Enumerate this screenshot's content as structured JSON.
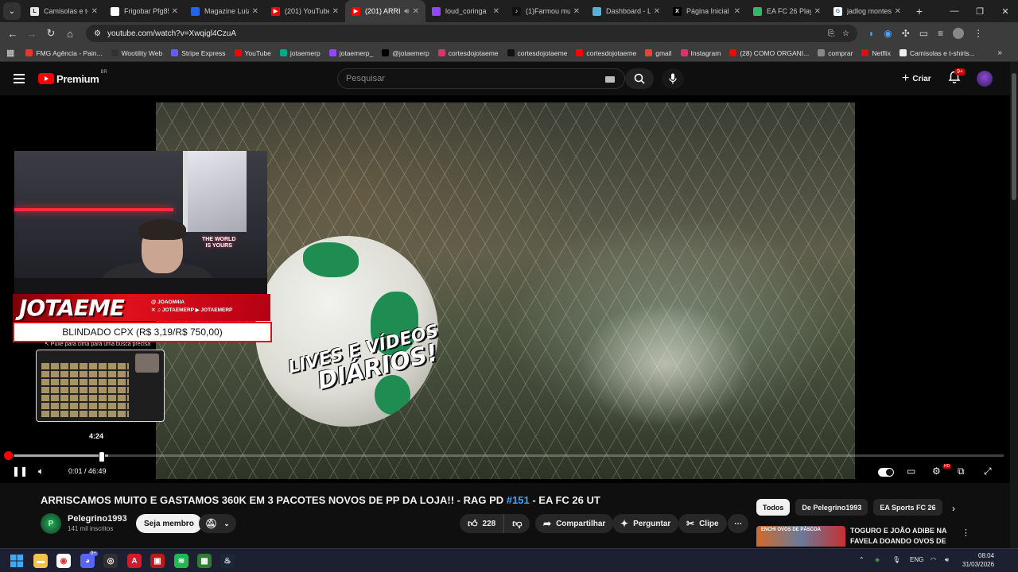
{
  "browser": {
    "tabs": [
      {
        "title": "Camisolas e t-s",
        "icon_color": "#e6e6e6",
        "icon_text": "L",
        "icon_text_color": "#111"
      },
      {
        "title": "Frigobar Pfg85",
        "icon_color": "#ffffff",
        "icon_text": "",
        "icon_text_color": "#111"
      },
      {
        "title": "Magazine Luiza",
        "icon_color": "#2463eb",
        "icon_text": "",
        "icon_text_color": "#fff"
      },
      {
        "title": "(201) YouTube",
        "icon_color": "#ff0000",
        "icon_text": "▶",
        "icon_text_color": "#fff"
      },
      {
        "title": "(201) ARRI",
        "icon_color": "#ff0000",
        "icon_text": "▶",
        "icon_text_color": "#fff"
      },
      {
        "title": "loud_coringa",
        "icon_color": "#9146ff",
        "icon_text": "",
        "icon_text_color": "#fff"
      },
      {
        "title": "(1)Farmou mui",
        "icon_color": "#111111",
        "icon_text": "♪",
        "icon_text_color": "#fff"
      },
      {
        "title": "Dashboard - L",
        "icon_color": "#5ab0d6",
        "icon_text": "",
        "icon_text_color": "#fff"
      },
      {
        "title": "Página Inicial /",
        "icon_color": "#000000",
        "icon_text": "X",
        "icon_text_color": "#fff"
      },
      {
        "title": "EA FC 26 Playe",
        "icon_color": "#2fb86a",
        "icon_text": "",
        "icon_text_color": "#fff"
      },
      {
        "title": "jadlog montes",
        "icon_color": "#ffffff",
        "icon_text": "G",
        "icon_text_color": "#4285f4"
      }
    ],
    "active_tab": 4,
    "new_tab": "+",
    "url": "youtube.com/watch?v=Xwqigl4CzuA",
    "bookmarks": [
      {
        "label": "FMG Agência - Pain...",
        "color": "#e33"
      },
      {
        "label": "Wootility Web",
        "color": "#333"
      },
      {
        "label": "Stripe Express",
        "color": "#635bff"
      },
      {
        "label": "YouTube",
        "color": "#f00"
      },
      {
        "label": "jotaemerp",
        "color": "#0a8"
      },
      {
        "label": "jotaemerp_",
        "color": "#9146ff"
      },
      {
        "label": "@jotaemerp",
        "color": "#000"
      },
      {
        "label": "cortesdojotaeme",
        "color": "#e1306c"
      },
      {
        "label": "cortesdojotaeme",
        "color": "#111"
      },
      {
        "label": "cortesdojotaeme",
        "color": "#f00"
      },
      {
        "label": "gmail",
        "color": "#ea4335"
      },
      {
        "label": "Instagram",
        "color": "#e1306c"
      },
      {
        "label": "(28) COMO ORGANI...",
        "color": "#f00"
      },
      {
        "label": "comprar",
        "color": "#888"
      },
      {
        "label": "Netflix",
        "color": "#e50914"
      },
      {
        "label": "Camisolas e t-shirts...",
        "color": "#eee"
      }
    ]
  },
  "youtube": {
    "logo_text": "Premium",
    "logo_region": "BR",
    "search_placeholder": "Pesquisar",
    "create_label": "Criar",
    "notifications_badge": "9+",
    "player": {
      "overlay_text_line1": "LIVES E VÍDEOS",
      "overlay_text_line2": "DIÁRIOS!",
      "streamer_name": "JOTAEME",
      "socials": [
        "@ JOAOM4IA",
        "✕ ♫ JOTAEMERP  ▶ JOTAEMERP"
      ],
      "cam_sign": "THE WORLD\nIS YOURS",
      "price_bar": "BLINDADO CPX (R$ 3,19/R$ 750,00)",
      "hint_text": "↖ Puxe para cima para uma busca precisa",
      "preview_time": "4:24",
      "current_time": "0:01",
      "duration": "46:49",
      "time_display": "0:01 / 46:49",
      "played_fraction": 0.0004,
      "hover_fraction": 0.094,
      "settings_badge": "HD"
    },
    "video": {
      "title_main": "ARRISCAMOS MUITO E GASTAMOS 360K EM 3 PACOTES NOVOS DE PP DA LOJA!! - RAG PD ",
      "title_tag": "#151",
      "title_end": " - EA FC 26 UT",
      "channel": "Pelegrino1993",
      "channel_initial": "P",
      "subscribers": "141 mil inscritos",
      "member_button": "Seja membro",
      "likes": "228",
      "share": "Compartilhar",
      "ask": "Perguntar",
      "clip": "Clipe",
      "more": "⋯"
    },
    "chips": [
      "Todos",
      "De Pelegrino1993",
      "EA Sports FC 26"
    ],
    "recommended": {
      "title": "TOGURO E JOÃO ADIBE NA FAVELA DOANDO OVOS DE ...",
      "thumb_text": "ENCHI OVOS DE PÁSCOA"
    }
  },
  "taskbar": {
    "apps": [
      {
        "name": "file-explorer",
        "color": "#f2c14e",
        "glyph": "▬"
      },
      {
        "name": "chrome",
        "color": "#ffffff",
        "glyph": "◉"
      },
      {
        "name": "discord",
        "color": "#5865f2",
        "glyph": "◕"
      },
      {
        "name": "obs",
        "color": "#303030",
        "glyph": "◎"
      },
      {
        "name": "app-red-a",
        "color": "#d11a2a",
        "glyph": "A"
      },
      {
        "name": "app-red-b",
        "color": "#b71c1c",
        "glyph": "▣"
      },
      {
        "name": "spotify",
        "color": "#1db954",
        "glyph": "≋"
      },
      {
        "name": "app-green",
        "color": "#2e7d32",
        "glyph": "▦"
      },
      {
        "name": "steam",
        "color": "#1b2838",
        "glyph": "♨"
      }
    ],
    "discord_badge": "9+",
    "lang": "ENG",
    "time": "08:04",
    "date": "31/03/2026"
  }
}
